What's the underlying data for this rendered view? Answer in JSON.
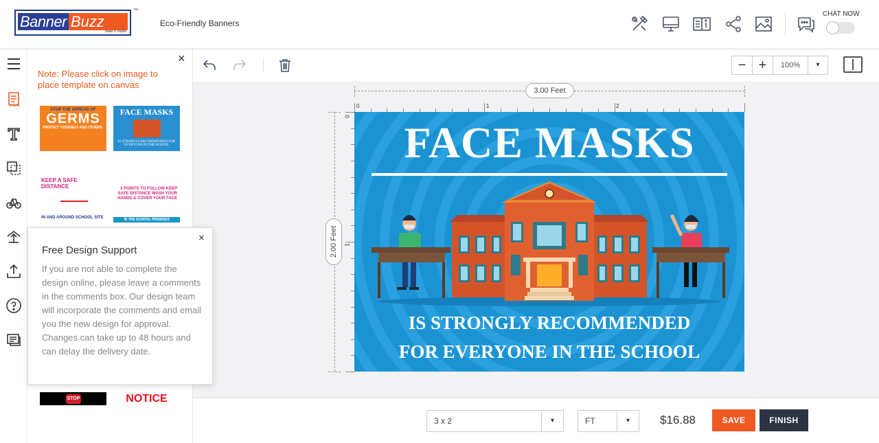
{
  "header": {
    "logo_part1": "Banner",
    "logo_part2": "Buzz",
    "logo_tagline": "make it visible",
    "logo_tm": "™",
    "title": "Eco-Friendly Banners",
    "icons": [
      "tools-icon",
      "monitor-icon",
      "book-info-icon",
      "share-icon",
      "image-icon",
      "chat-icon"
    ],
    "chat_label": "CHAT NOW"
  },
  "rail": {
    "icons": [
      "menu-icon",
      "templates-icon",
      "text-icon",
      "shapes-icon",
      "clipart-icon",
      "background-icon",
      "upload-icon",
      "help-icon",
      "comments-icon"
    ]
  },
  "panel": {
    "close": "×",
    "note": "Note: Please click on image to place template on canvas",
    "thumbs": {
      "t1_small": "STOP THE SPREAD OF",
      "t1_big": "GERMS",
      "t1_sub": "PROTECT YOURSELF AND OTHERS",
      "t2_title": "FACE MASKS",
      "t2_sub": "IS STRONGLY RECOMMENDED FOR EVERYONE IN THE SCHOOL",
      "t3_title": "KEEP A SAFE DISTANCE",
      "t3_sub": "IN AND AROUND SCHOOL SITE",
      "t4_title": "3 POINTS TO FOLLOW KEEP SAFE DISTANCE WASH YOUR HANDS & COVER YOUR FACE",
      "t4_bar": "IN THE SCHOOL PREMISES",
      "t5_stop": "STOP",
      "t6_notice": "NOTICE"
    }
  },
  "popup": {
    "close": "×",
    "title": "Free Design Support",
    "body": "If you are not able to complete the design online, please leave a comments in the comments box. Our design team will incorporate the comments and email you the new design for approval. Changes can take up to 48 hours and can delay the delivery date."
  },
  "toolbar": {
    "zoom_minus": "−",
    "zoom_plus": "+",
    "zoom_value": "100%",
    "zoom_dropdown": "▾"
  },
  "canvas": {
    "width_label": "3.00 Feet",
    "height_label": "2.00 Feet",
    "ruler_top": [
      "0",
      "1",
      "2"
    ],
    "ruler_left": [
      "0",
      "1"
    ]
  },
  "design": {
    "title": "FACE MASKS",
    "line2": "IS STRONGLY RECOMMENDED",
    "line3": "FOR EVERYONE IN THE SCHOOL",
    "bg_color": "#1b93d2"
  },
  "bottombar": {
    "size_value": "3 x 2",
    "unit_value": "FT",
    "price": "$16.88",
    "save_label": "SAVE",
    "finish_label": "FINISH",
    "accent": "#f05a22",
    "dark": "#2c3443"
  }
}
